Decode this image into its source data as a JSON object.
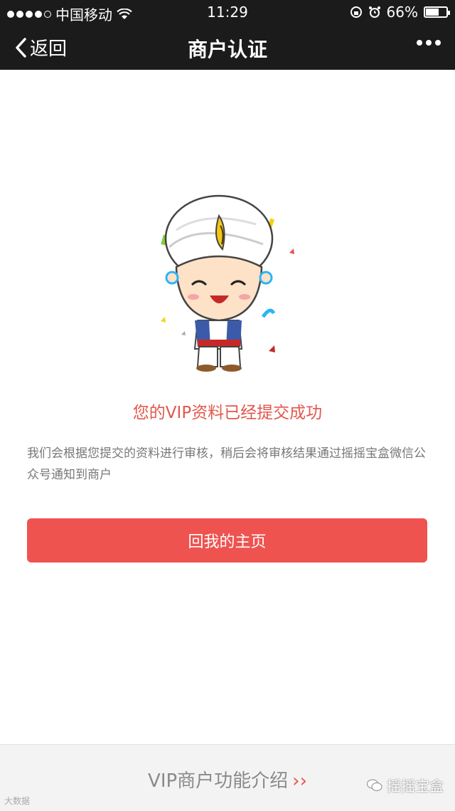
{
  "status_bar": {
    "carrier": "中国移动",
    "time": "11:29",
    "battery": "66%",
    "battery_level": 0.66
  },
  "nav": {
    "back_label": "返回",
    "title": "商户认证"
  },
  "main": {
    "success_text": "您的VIP资料已经提交成功",
    "description": "我们会根据您提交的资料进行审核，稍后会将审核结果通过摇摇宝盒微信公众号通知到商户",
    "home_button_label": "回我的主页"
  },
  "footer": {
    "feature_link": "VIP商户功能介绍",
    "feature_arrow": "››",
    "watermark_left": "大数据",
    "watermark_right": "摇摇宝盒"
  }
}
